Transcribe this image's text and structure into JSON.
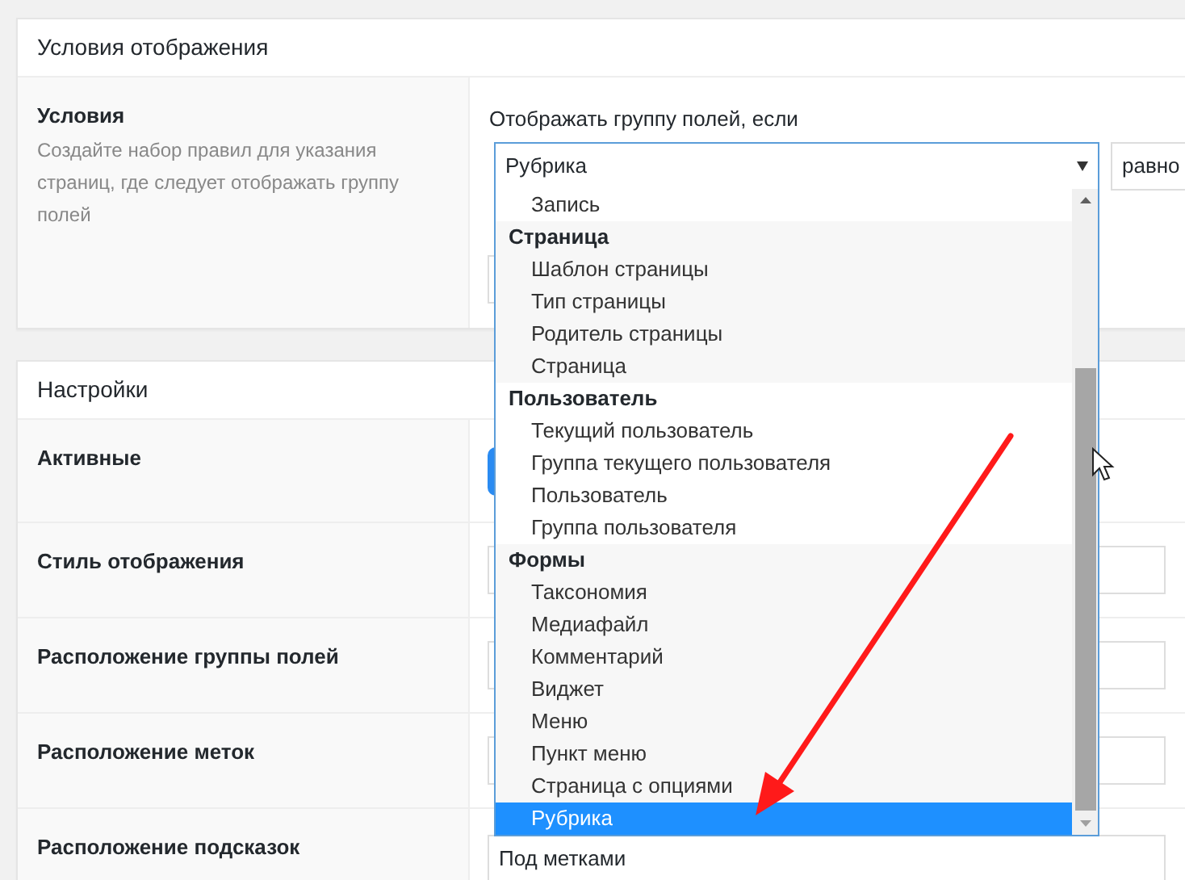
{
  "location_panel": {
    "title": "Условия отображения",
    "rules_label": "Условия",
    "rules_description": "Создайте набор правил для указания страниц, где следует отображать группу полей",
    "condition_heading": "Отображать группу полей, если",
    "param_select": {
      "value": "Рубрика",
      "expanded": true
    },
    "operator_select": {
      "value": "равно"
    },
    "dropdown": {
      "groups": [
        {
          "options": [
            {
              "label": "Запись",
              "selected": false
            }
          ]
        },
        {
          "label": "Страница",
          "options": [
            {
              "label": "Шаблон страницы",
              "selected": false
            },
            {
              "label": "Тип страницы",
              "selected": false
            },
            {
              "label": "Родитель страницы",
              "selected": false
            },
            {
              "label": "Страница",
              "selected": false
            }
          ]
        },
        {
          "label": "Пользователь",
          "options": [
            {
              "label": "Текущий пользователь",
              "selected": false
            },
            {
              "label": "Группа текущего пользователя",
              "selected": false
            },
            {
              "label": "Пользователь",
              "selected": false
            },
            {
              "label": "Группа пользователя",
              "selected": false
            }
          ]
        },
        {
          "label": "Формы",
          "options": [
            {
              "label": "Таксономия",
              "selected": false
            },
            {
              "label": "Медиафайл",
              "selected": false
            },
            {
              "label": "Комментарий",
              "selected": false
            },
            {
              "label": "Виджет",
              "selected": false
            },
            {
              "label": "Меню",
              "selected": false
            },
            {
              "label": "Пункт меню",
              "selected": false
            },
            {
              "label": "Страница с опциями",
              "selected": false
            },
            {
              "label": "Рубрика",
              "selected": true
            }
          ]
        }
      ]
    }
  },
  "settings_panel": {
    "title": "Настройки",
    "rows": [
      {
        "label": "Активные",
        "kind": "toggle",
        "on": true
      },
      {
        "label": "Стиль отображения",
        "kind": "select"
      },
      {
        "label": "Расположение группы полей",
        "kind": "select"
      },
      {
        "label": "Расположение меток",
        "kind": "select"
      },
      {
        "label": "Расположение подсказок",
        "kind": "select",
        "value": "Под метками"
      }
    ]
  }
}
